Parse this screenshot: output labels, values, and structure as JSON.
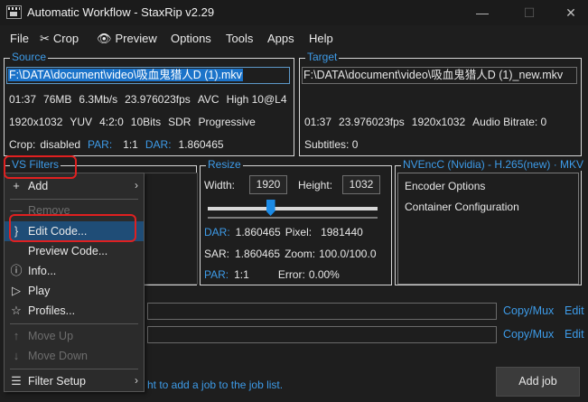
{
  "window": {
    "title": "Automatic Workflow - StaxRip v2.29",
    "minimize_glyph": "—",
    "maximize_glyph": "☐",
    "close_glyph": "✕"
  },
  "menu": {
    "file": "File",
    "crop": "Crop",
    "preview": "Preview",
    "options": "Options",
    "tools": "Tools",
    "apps": "Apps",
    "help": "Help",
    "crop_icon": "scissors-icon",
    "preview_icon": "eye-icon"
  },
  "source": {
    "label": "Source",
    "path": "F:\\DATA\\document\\video\\吸血鬼猎人D (1).mkv",
    "line1": [
      "01:37",
      "76MB",
      "6.3Mb/s",
      "23.976023fps",
      "AVC",
      "High 10@L4"
    ],
    "line2": [
      "1920x1032",
      "YUV",
      "4:2:0",
      "10Bits",
      "SDR",
      "Progressive"
    ],
    "line3": {
      "crop_label": "Crop:",
      "crop_value": "disabled",
      "par_label": "PAR:",
      "par_value": "1:1",
      "dar_label": "DAR:",
      "dar_value": "1.860465"
    }
  },
  "target": {
    "label": "Target",
    "path": "F:\\DATA\\document\\video\\吸血鬼猎人D (1)_new.mkv",
    "line1": [
      "01:37",
      "23.976023fps",
      "1920x1032",
      "Audio Bitrate: 0"
    ],
    "subtitles": "Subtitles: 0"
  },
  "vs_filters": {
    "label": "VS Filters"
  },
  "resize": {
    "label": "Resize",
    "width_label": "Width:",
    "width_value": "1920",
    "height_label": "Height:",
    "height_value": "1032",
    "slider_fraction": 0.37,
    "dar_label": "DAR:",
    "dar_value": "1.860465",
    "pixel_label": "Pixel:",
    "pixel_value": "1981440",
    "sar_label": "SAR:",
    "sar_value": "1.860465",
    "zoom_label": "Zoom:",
    "zoom_value": "100.0/100.0",
    "par_label": "PAR:",
    "par_value": "1:1",
    "error_label": "Error:",
    "error_value": "0.00%"
  },
  "encoder": {
    "label": "NVEncC (Nvidia) - H.265(new) · MKV",
    "items": [
      "Encoder Options",
      "Container Configuration"
    ]
  },
  "audio_rows": [
    {
      "copy_mux": "Copy/Mux",
      "edit": "Edit"
    },
    {
      "copy_mux": "Copy/Mux",
      "edit": "Edit"
    }
  ],
  "status": {
    "text": "ht to add a job to the job list."
  },
  "add_job_button": "Add job",
  "context_menu": {
    "items": [
      {
        "label": "Add",
        "icon": "plus-icon",
        "glyph": "+",
        "submenu": true,
        "disabled": false
      },
      {
        "label": "Remove",
        "icon": "minus-icon",
        "glyph": "—",
        "submenu": false,
        "disabled": true
      },
      {
        "label": "Edit Code...",
        "icon": "brace-icon",
        "glyph": "}",
        "submenu": false,
        "disabled": false,
        "selected": true
      },
      {
        "label": "Preview Code...",
        "icon": "",
        "glyph": "",
        "submenu": false,
        "disabled": false
      },
      {
        "label": "Info...",
        "icon": "info-icon",
        "glyph": "ⓘ",
        "submenu": false,
        "disabled": false
      },
      {
        "label": "Play",
        "icon": "play-icon",
        "glyph": "▷",
        "submenu": false,
        "disabled": false
      },
      {
        "label": "Profiles...",
        "icon": "star-icon",
        "glyph": "☆",
        "submenu": false,
        "disabled": false
      },
      {
        "label": "Move Up",
        "icon": "arrow-up-icon",
        "glyph": "↑",
        "submenu": false,
        "disabled": true
      },
      {
        "label": "Move Down",
        "icon": "arrow-down-icon",
        "glyph": "↓",
        "submenu": false,
        "disabled": true
      },
      {
        "label": "Filter Setup",
        "icon": "list-icon",
        "glyph": "☰",
        "submenu": true,
        "disabled": false
      }
    ],
    "submenu_arrow": "›"
  },
  "colors": {
    "accent": "#3d9be8",
    "selection": "#1b73c9",
    "highlight_annotation": "#e02020"
  }
}
